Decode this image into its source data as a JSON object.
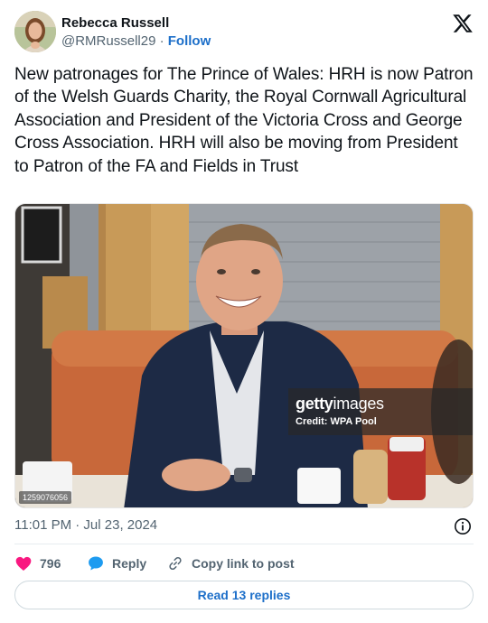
{
  "author": {
    "display_name": "Rebecca Russell",
    "handle": "@RMRussell29",
    "separator": "·",
    "follow_label": "Follow"
  },
  "tweet": {
    "text": "New patronages for The Prince of Wales: HRH is now Patron of the Welsh Guards Charity, the Royal Cornwall Agricultural Association and President of the Victoria Cross and George Cross Association. HRH will also be moving from President to Patron of the FA and Fields in Trust"
  },
  "photo": {
    "watermark_brand_bold": "getty",
    "watermark_brand_light": "images",
    "watermark_credit": "Credit: WPA Pool",
    "image_id": "1259076056"
  },
  "meta": {
    "timestamp": "11:01 PM · Jul 23, 2024"
  },
  "actions": {
    "like_count": "796",
    "reply_label": "Reply",
    "copy_label": "Copy link to post"
  },
  "read_replies_label": "Read 13 replies",
  "colors": {
    "link_blue": "#1d6fc9",
    "heart_pink": "#f91880",
    "reply_blue": "#1d9bf0",
    "text_gray": "#536471"
  },
  "icons": {
    "logo": "x-logo-icon",
    "info": "info-icon",
    "like": "heart-icon",
    "reply": "speech-bubble-icon",
    "copy": "link-icon"
  }
}
